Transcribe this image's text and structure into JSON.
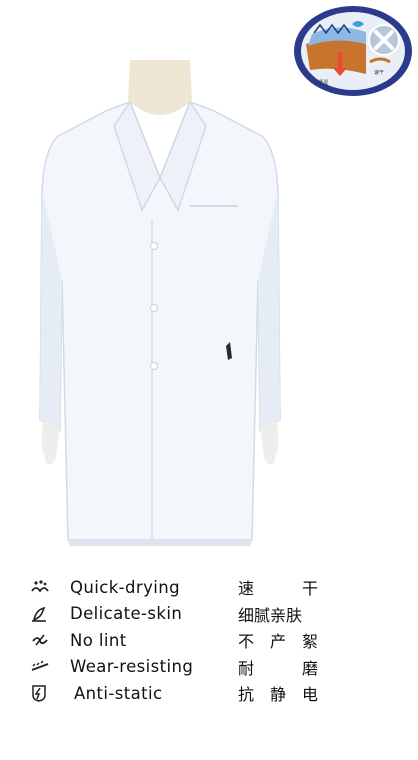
{
  "badge": {
    "label_left": "透湿",
    "label_right": "速干"
  },
  "features": [
    {
      "icon": "quick-dry-icon",
      "en": "Quick-drying",
      "cn": [
        "速",
        "干"
      ]
    },
    {
      "icon": "skin-icon",
      "en": "Delicate-skin",
      "cn": [
        "细腻亲肤"
      ]
    },
    {
      "icon": "no-lint-icon",
      "en": "No lint",
      "cn": [
        "不",
        "产",
        "絮"
      ]
    },
    {
      "icon": "wear-resist-icon",
      "en": "Wear-resisting",
      "cn": [
        "耐",
        "磨"
      ]
    },
    {
      "icon": "anti-static-icon",
      "en": "Anti-static",
      "cn": [
        "抗",
        "静",
        "电"
      ]
    }
  ]
}
